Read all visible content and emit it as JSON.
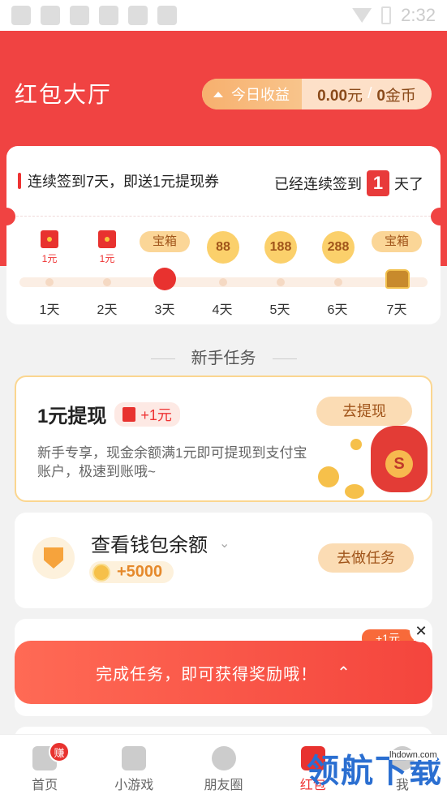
{
  "status_bar": {
    "time": "2:32"
  },
  "header": {
    "title": "红包大厅",
    "earnings_label": "今日收益",
    "cash_value": "0.00",
    "cash_unit": "元",
    "separator": "/",
    "coin_value": "0",
    "coin_unit": "金币"
  },
  "signin": {
    "headline": "连续签到7天，即送1元提现券",
    "streak_prefix": "已经连续签到",
    "streak_days": "1",
    "streak_suffix": "天了",
    "days": [
      {
        "label": "1天",
        "reward": "1元",
        "kind": "redpacket"
      },
      {
        "label": "2天",
        "reward": "1元",
        "kind": "redpacket"
      },
      {
        "label": "3天",
        "reward": "宝箱",
        "kind": "box"
      },
      {
        "label": "4天",
        "reward": "88",
        "kind": "coin"
      },
      {
        "label": "5天",
        "reward": "188",
        "kind": "coin"
      },
      {
        "label": "6天",
        "reward": "288",
        "kind": "coin"
      },
      {
        "label": "7天",
        "reward": "宝箱",
        "kind": "box"
      }
    ]
  },
  "section": {
    "title": "新手任务"
  },
  "tasks": {
    "withdraw": {
      "title": "1元提现",
      "reward": "+1元",
      "desc": "新手专享，现金余额满1元即可提现到支付宝账户，极速到账哦~",
      "button": "去提现"
    },
    "wallet": {
      "title": "查看钱包余额",
      "reward": "+5000",
      "button": "去做任务"
    }
  },
  "toast": {
    "text": "完成任务，即可获得奖励哦！",
    "close": "✕",
    "badge": "+1元"
  },
  "tabbar": {
    "tabs": [
      {
        "label": "首页",
        "badge": "赚"
      },
      {
        "label": "小游戏"
      },
      {
        "label": "朋友圈"
      },
      {
        "label": "红包"
      },
      {
        "label": "我"
      }
    ]
  },
  "watermark": {
    "text": "领航下载",
    "url": "lhdown.com"
  }
}
